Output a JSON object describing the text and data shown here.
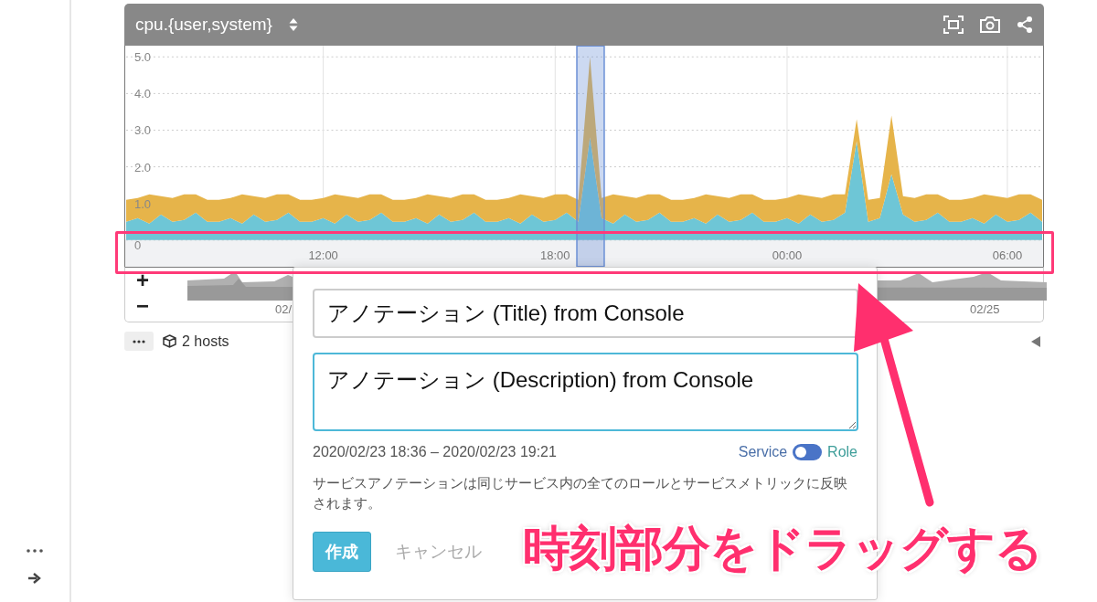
{
  "panel": {
    "title": "cpu.{user,system}",
    "chart_data": {
      "type": "area",
      "stacked": true,
      "grid": true,
      "ylim": [
        0,
        5.3
      ],
      "categories": [
        null,
        null,
        null,
        null,
        null,
        null,
        null,
        null,
        null,
        null,
        null,
        null,
        null,
        null,
        null,
        null,
        null,
        "12:00",
        null,
        null,
        null,
        null,
        null,
        null,
        null,
        null,
        null,
        null,
        null,
        null,
        null,
        null,
        null,
        null,
        null,
        null,
        null,
        "18:00",
        null,
        null,
        null,
        null,
        null,
        null,
        null,
        null,
        null,
        null,
        null,
        null,
        null,
        null,
        null,
        null,
        null,
        null,
        null,
        "00:00",
        null,
        null,
        null,
        null,
        null,
        null,
        null,
        null,
        null,
        null,
        null,
        null,
        null,
        null,
        null,
        null,
        null,
        null,
        "06:00",
        null,
        null,
        null
      ],
      "yticks": [
        {
          "value": 0,
          "label": "0"
        },
        {
          "value": 1,
          "label": "1.0"
        },
        {
          "value": 2,
          "label": "2.0"
        },
        {
          "value": 3,
          "label": "3.0"
        },
        {
          "value": 4,
          "label": "4.0"
        },
        {
          "value": 5,
          "label": "5.0"
        }
      ],
      "series": [
        {
          "color": "#6ec6d6",
          "values": [
            0.5,
            0.6,
            0.45,
            0.7,
            0.5,
            0.55,
            0.75,
            0.5,
            0.5,
            0.6,
            0.45,
            0.7,
            0.5,
            0.55,
            0.75,
            0.5,
            0.5,
            0.6,
            0.45,
            0.7,
            0.5,
            0.55,
            0.75,
            0.5,
            0.5,
            0.6,
            0.45,
            0.7,
            0.5,
            0.55,
            0.75,
            0.5,
            0.5,
            0.6,
            0.45,
            0.7,
            0.5,
            0.55,
            0.75,
            0.5,
            2.8,
            0.6,
            0.45,
            0.7,
            0.5,
            0.55,
            0.75,
            0.5,
            0.5,
            0.6,
            0.45,
            0.7,
            0.5,
            0.55,
            0.75,
            0.5,
            0.5,
            0.6,
            0.45,
            0.7,
            0.5,
            0.55,
            0.75,
            2.7,
            0.5,
            0.6,
            1.8,
            0.7,
            0.5,
            0.55,
            0.75,
            0.5,
            0.5,
            0.6,
            0.45,
            0.7,
            0.5,
            0.55,
            0.75,
            0.5
          ]
        },
        {
          "color": "#e6b44a",
          "values": [
            0.6,
            0.55,
            0.8,
            0.5,
            0.65,
            0.7,
            0.5,
            0.6,
            0.6,
            0.55,
            0.8,
            0.5,
            0.65,
            0.7,
            0.5,
            0.6,
            0.6,
            0.55,
            0.8,
            0.5,
            0.65,
            0.7,
            0.5,
            0.6,
            0.6,
            0.55,
            0.8,
            0.5,
            0.65,
            0.7,
            0.5,
            0.6,
            0.6,
            0.55,
            0.8,
            0.5,
            0.65,
            0.7,
            0.5,
            0.6,
            2.2,
            0.55,
            0.8,
            0.5,
            0.65,
            0.7,
            0.5,
            0.6,
            0.6,
            0.55,
            0.8,
            0.5,
            0.65,
            0.7,
            0.5,
            0.6,
            0.6,
            0.55,
            0.8,
            0.5,
            0.65,
            0.7,
            0.5,
            0.6,
            0.6,
            0.55,
            1.6,
            0.5,
            0.65,
            0.7,
            0.5,
            0.6,
            0.6,
            0.55,
            0.8,
            0.5,
            0.65,
            0.7,
            0.5,
            0.6
          ]
        }
      ]
    },
    "navigator": {
      "zoom_in": "+",
      "zoom_out": "−",
      "labels": [
        "02/",
        "02/25"
      ]
    },
    "hosts": "2 hosts"
  },
  "annotation_form": {
    "title_value": "アノテーション (Title) from Console",
    "description_value": "アノテーション (Description) from Console",
    "range": "2020/02/23 18:36 – 2020/02/23 19:21",
    "scope_toggle": {
      "left_label": "Service",
      "right_label": "Role",
      "on": false
    },
    "note": "サービスアノテーションは同じサービス内の全てのロールとサービスメトリックに反映されます。",
    "buttons": [
      {
        "label": "作成",
        "kind": "primary"
      },
      {
        "label": "キャンセル",
        "kind": "link"
      }
    ]
  },
  "callout": {
    "text": "時刻部分をドラッグする"
  }
}
